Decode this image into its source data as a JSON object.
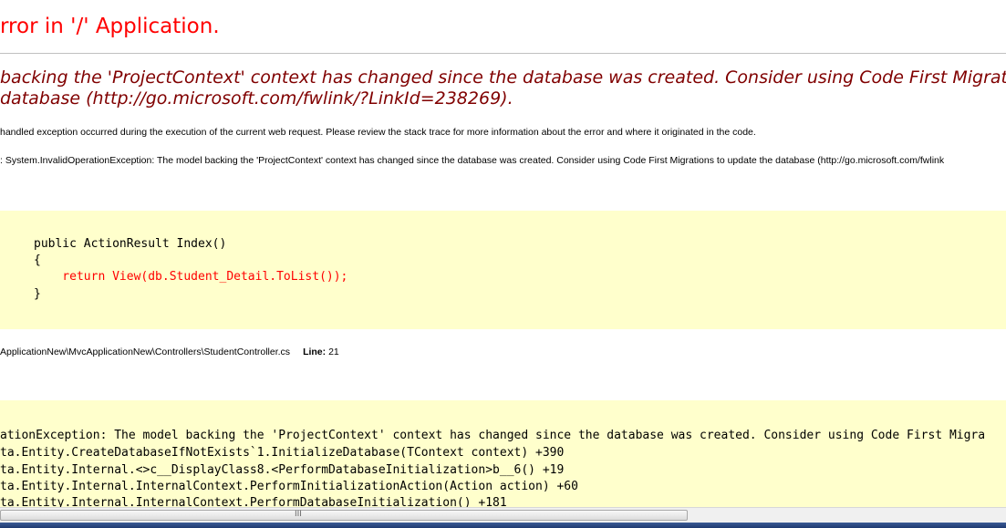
{
  "page": {
    "title": "rror in '/' Application.",
    "message_line1": "backing the 'ProjectContext' context has changed since the database was created. Consider using Code First Migration",
    "message_line2": "database (http://go.microsoft.com/fwlink/?LinkId=238269).",
    "description": "handled exception occurred during the execution of the current web request. Please review the stack trace for more information about the error and where it originated in the code.",
    "exception_details": ": System.InvalidOperationException: The model backing the 'ProjectContext' context has changed since the database was created. Consider using Code First Migrations to update the database (http://go.microsoft.com/fwlink"
  },
  "source_code": {
    "lines": [
      "public ActionResult Index()",
      "{",
      "    return View(db.Student_Detail.ToList());",
      "}"
    ]
  },
  "source_file": {
    "path": "ApplicationNew\\MvcApplicationNew\\Controllers\\StudentController.cs",
    "line_label": "Line:",
    "line_number": "21"
  },
  "stack_trace": {
    "lines": [
      "ationException: The model backing the 'ProjectContext' context has changed since the database was created. Consider using Code First Migra",
      "ta.Entity.CreateDatabaseIfNotExists`1.InitializeDatabase(TContext context) +390",
      "ta.Entity.Internal.<>c__DisplayClass8.<PerformDatabaseInitialization>b__6() +19",
      "ta.Entity.Internal.InternalContext.PerformInitializationAction(Action action) +60",
      "ta.Entity.Internal.InternalContext.PerformDatabaseInitialization() +181"
    ]
  },
  "scrollbar": {
    "grip": "III"
  },
  "colors": {
    "title": "#ff0000",
    "message": "#800000",
    "code_background": "#ffffcc",
    "error_line": "#ff0000"
  }
}
